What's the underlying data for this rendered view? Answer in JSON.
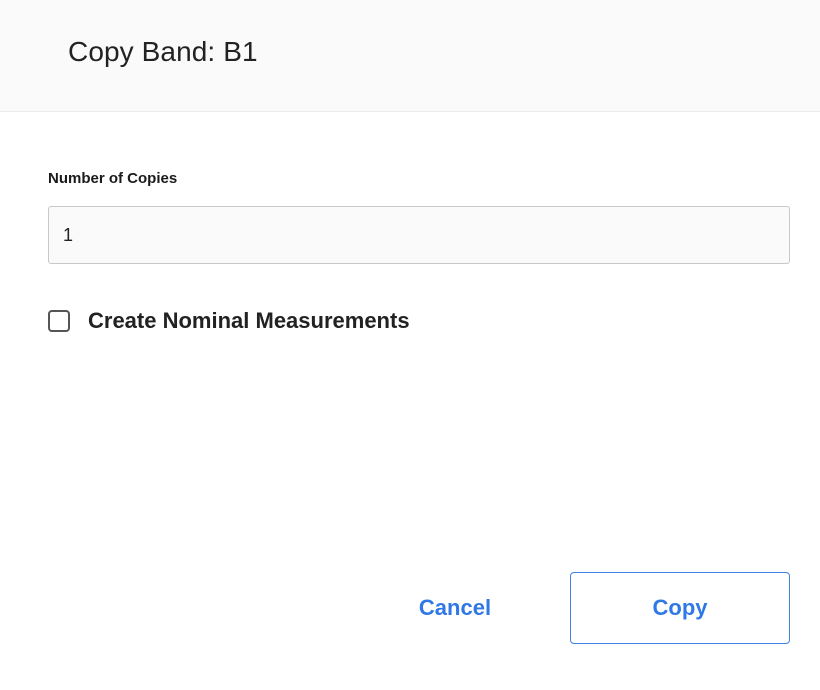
{
  "dialog": {
    "title": "Copy Band: B1"
  },
  "number_of_copies": {
    "label": "Number of Copies",
    "value": "1"
  },
  "create_nominal": {
    "label": "Create Nominal Measurements",
    "checked": false
  },
  "actions": {
    "cancel_label": "Cancel",
    "copy_label": "Copy"
  },
  "colors": {
    "accent": "#2f78e6",
    "header_bg": "#fafafa",
    "input_bg": "#fafafa",
    "text": "#222222"
  }
}
